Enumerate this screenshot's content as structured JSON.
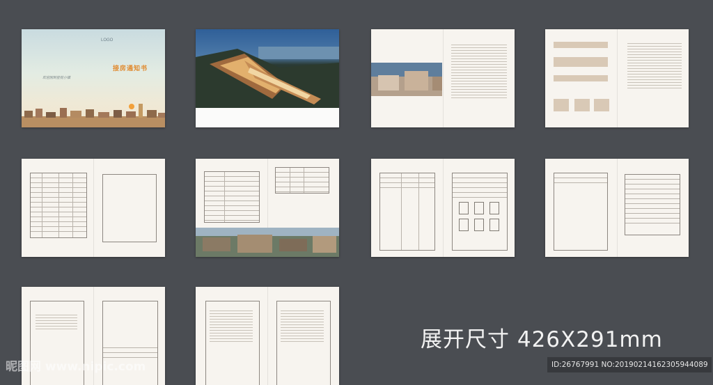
{
  "cover": {
    "logo": "LOGO",
    "title": "接房通知书",
    "slogan": "欢迎回到星枕小镇"
  },
  "caption_dims": "展开尺寸 426X291mm",
  "watermark": "昵图网 www.nipic.com",
  "image_id": "ID:26767991 NO:20190214162305944089",
  "colors": {
    "background": "#4a4d52",
    "paper": "#f7f4ef",
    "accent_title": "#e1892d",
    "flow_box": "#d9c9b6"
  }
}
